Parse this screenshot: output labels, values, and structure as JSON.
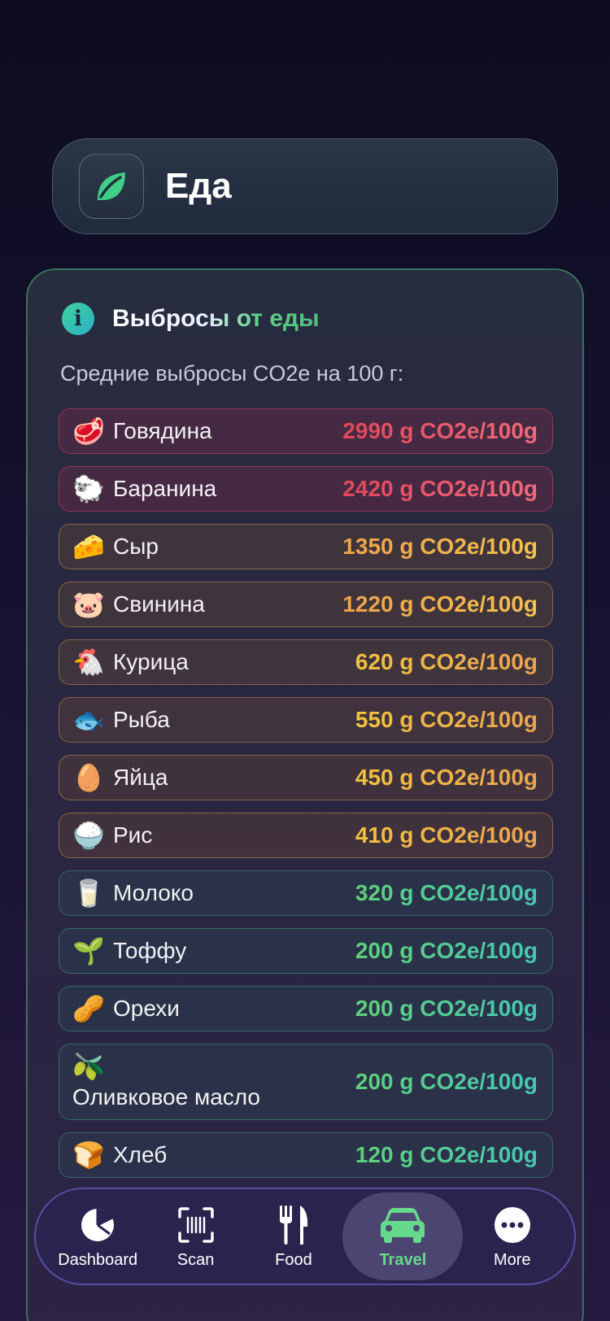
{
  "header": {
    "title": "Еда",
    "icon": "leaf-icon"
  },
  "info": {
    "title": "Выбросы от еды",
    "subtitle": "Средние выбросы CO2e на 100 г:",
    "items": [
      {
        "emoji": "🥩",
        "name": "Говядина",
        "value": "2990 g CO2e/100g",
        "level": "red"
      },
      {
        "emoji": "🐑",
        "name": "Баранина",
        "value": "2420 g CO2e/100g",
        "level": "red"
      },
      {
        "emoji": "🧀",
        "name": "Сыр",
        "value": "1350 g CO2e/100g",
        "level": "orange"
      },
      {
        "emoji": "🐷",
        "name": "Свинина",
        "value": "1220 g CO2e/100g",
        "level": "orange"
      },
      {
        "emoji": "🐔",
        "name": "Курица",
        "value": "620 g CO2e/100g",
        "level": "orange"
      },
      {
        "emoji": "🐟",
        "name": "Рыба",
        "value": "550 g CO2e/100g",
        "level": "orange"
      },
      {
        "emoji": "🥚",
        "name": "Яйца",
        "value": "450 g CO2e/100g",
        "level": "orange"
      },
      {
        "emoji": "🍚",
        "name": "Рис",
        "value": "410 g CO2e/100g",
        "level": "orange"
      },
      {
        "emoji": "🥛",
        "name": "Молоко",
        "value": "320 g CO2e/100g",
        "level": "green"
      },
      {
        "emoji": "🌱",
        "name": "Тоффу",
        "value": "200 g CO2e/100g",
        "level": "green"
      },
      {
        "emoji": "🥜",
        "name": "Орехи",
        "value": "200 g CO2e/100g",
        "level": "green"
      },
      {
        "emoji": "🫒",
        "name": "Оливковое масло",
        "value": "200 g CO2e/100g",
        "level": "green"
      },
      {
        "emoji": "🍞",
        "name": "Хлеб",
        "value": "120 g CO2e/100g",
        "level": "green"
      }
    ]
  },
  "tabs": [
    {
      "label": "Dashboard",
      "icon": "pie-chart-icon",
      "active": false
    },
    {
      "label": "Scan",
      "icon": "barcode-scan-icon",
      "active": false
    },
    {
      "label": "Food",
      "icon": "fork-knife-icon",
      "active": false
    },
    {
      "label": "Travel",
      "icon": "car-icon",
      "active": true
    },
    {
      "label": "More",
      "icon": "more-dots-icon",
      "active": false
    }
  ],
  "colors": {
    "accent_green": "#65d98c",
    "high": "#e0475a",
    "medium": "#f3c23d",
    "low": "#5fd07a"
  }
}
